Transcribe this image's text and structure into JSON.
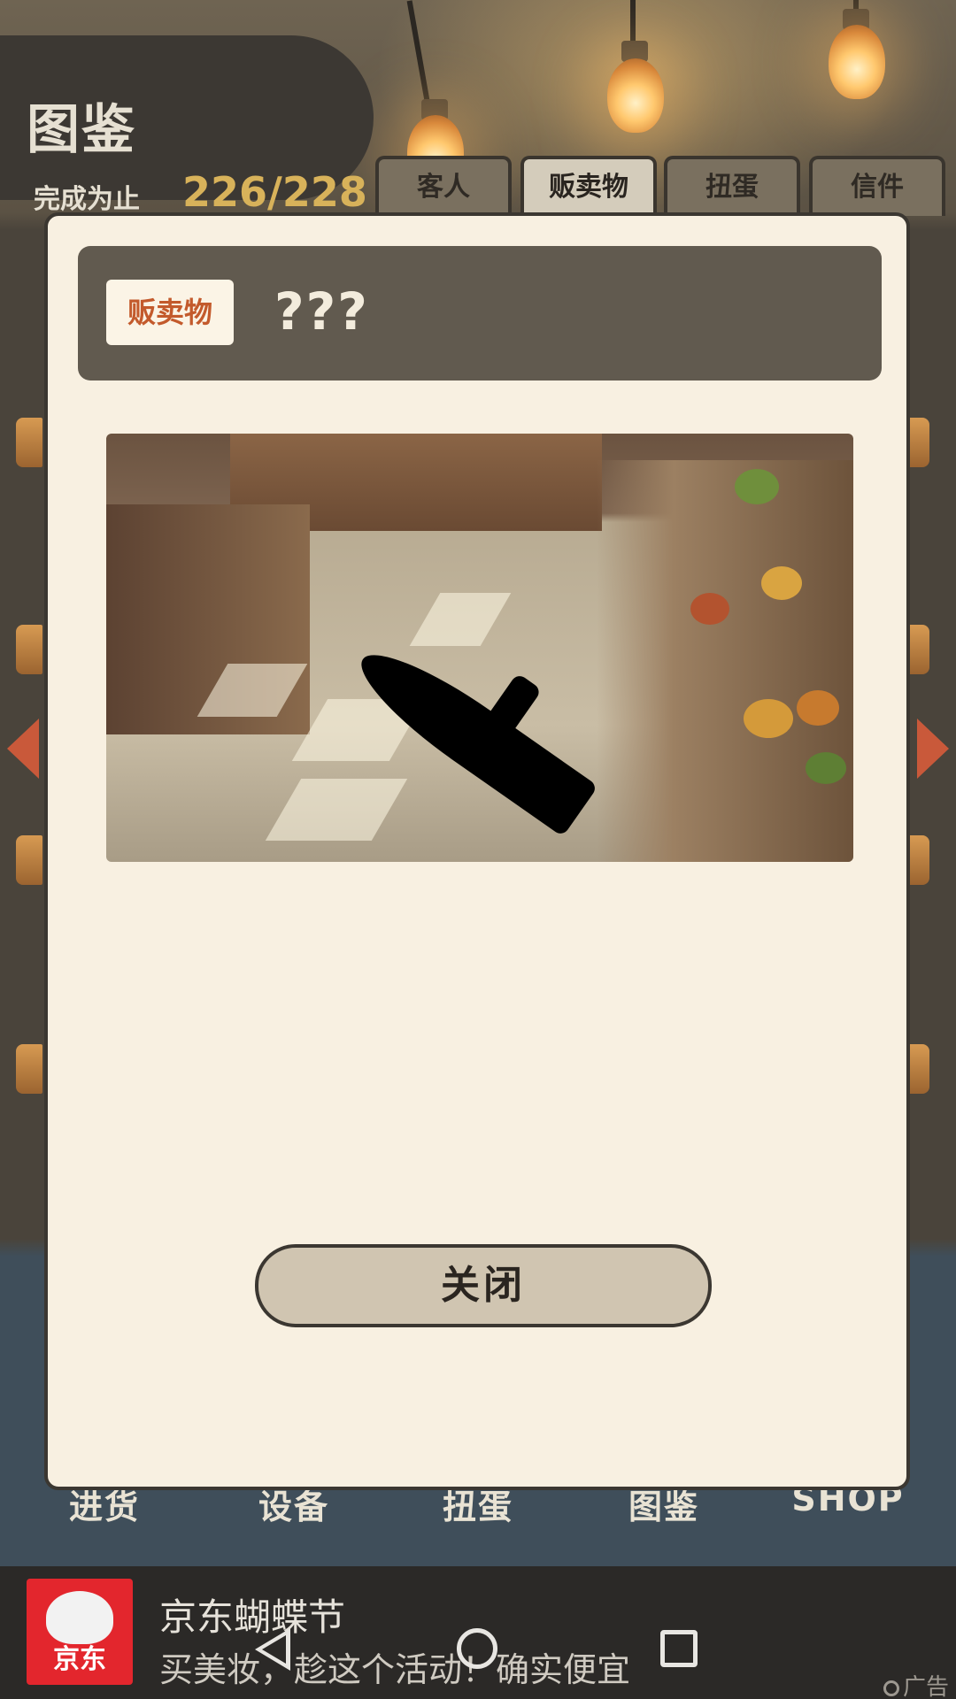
{
  "header": {
    "title": "图鉴",
    "progress_label": "完成为止",
    "progress_value": "226/228"
  },
  "tabs": [
    {
      "label": "客人",
      "active": false
    },
    {
      "label": "贩卖物",
      "active": true
    },
    {
      "label": "扭蛋",
      "active": false
    },
    {
      "label": "信件",
      "active": false
    }
  ],
  "bottom_nav": [
    "进货",
    "设备",
    "扭蛋",
    "图鉴",
    "SHOP"
  ],
  "modal": {
    "category_badge": "贩卖物",
    "item_name": "???",
    "close_label": "关闭"
  },
  "ad": {
    "logo_text": "京东",
    "title": "京东蝴蝶节",
    "subtitle": "买美妆，趁这个活动！确实便宜",
    "tag": "广告"
  },
  "colors": {
    "accent_gold": "#d8b25a",
    "badge_text": "#c35a2c",
    "modal_bg": "#f8f0e1",
    "header_bg": "#615a4f",
    "ad_red": "#e3262d"
  }
}
